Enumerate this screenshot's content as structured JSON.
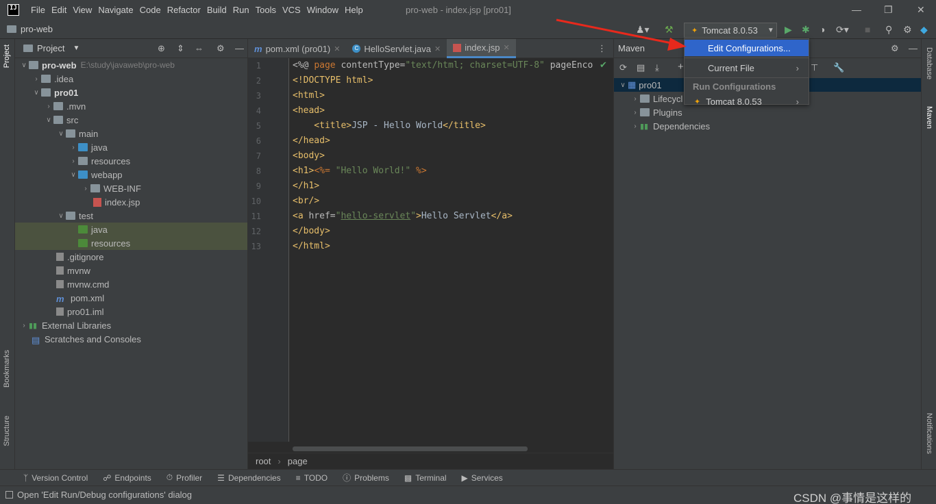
{
  "menubar": {
    "logo": "IJ",
    "items": [
      "File",
      "Edit",
      "View",
      "Navigate",
      "Code",
      "Refactor",
      "Build",
      "Run",
      "Tools",
      "VCS",
      "Window",
      "Help"
    ],
    "title": "pro-web - index.jsp [pro01]"
  },
  "navbar": {
    "project": "pro-web",
    "run_config": "Tomcat 8.0.53"
  },
  "left_strip": {
    "project": "Project",
    "bookmarks": "Bookmarks",
    "structure": "Structure"
  },
  "right_strip": {
    "database": "Database",
    "maven": "Maven",
    "notifications": "Notifications"
  },
  "project_panel": {
    "title": "Project",
    "tree": [
      {
        "label": "pro-web",
        "extra": "E:\\study\\javaweb\\pro-web"
      },
      {
        "label": ".idea"
      },
      {
        "label": "pro01"
      },
      {
        "label": ".mvn"
      },
      {
        "label": "src"
      },
      {
        "label": "main"
      },
      {
        "label": "java"
      },
      {
        "label": "resources"
      },
      {
        "label": "webapp"
      },
      {
        "label": "WEB-INF"
      },
      {
        "label": "index.jsp"
      },
      {
        "label": "test"
      },
      {
        "label": "java"
      },
      {
        "label": "resources"
      },
      {
        "label": ".gitignore"
      },
      {
        "label": "mvnw"
      },
      {
        "label": "mvnw.cmd"
      },
      {
        "label": "pom.xml"
      },
      {
        "label": "pro01.iml"
      },
      {
        "label": "External Libraries"
      },
      {
        "label": "Scratches and Consoles"
      }
    ]
  },
  "editor": {
    "tabs": [
      {
        "label": "pom.xml (pro01)"
      },
      {
        "label": "HelloServlet.java"
      },
      {
        "label": "index.jsp"
      }
    ],
    "line_numbers": [
      "1",
      "2",
      "3",
      "4",
      "5",
      "6",
      "7",
      "8",
      "9",
      "10",
      "11",
      "12",
      "13"
    ],
    "code": {
      "l1a": "<%@ ",
      "l1b": "page ",
      "l1c": "contentType=",
      "l1d": "\"text/html; charset=UTF-8\"",
      "l1e": " pageEnco",
      "l2": "<!DOCTYPE html>",
      "l3": "<html>",
      "l4": "<head>",
      "l5a": "    <title>",
      "l5b": "JSP - Hello World",
      "l5c": "</title>",
      "l6": "</head>",
      "l7": "<body>",
      "l8a": "<h1>",
      "l8b": "<%= ",
      "l8c": "\"Hello World!\"",
      "l8d": " %>",
      "l9": "</h1>",
      "l10": "<br/>",
      "l11a": "<a ",
      "l11b": "href=",
      "l11c": "\"",
      "l11d": "hello-servlet",
      "l11e": "\"",
      "l11f": ">",
      "l11g": "Hello Servlet",
      "l11h": "</a>",
      "l12": "</body>",
      "l13": "</html>"
    },
    "breadcrumb": [
      "root",
      "page"
    ]
  },
  "maven": {
    "title": "Maven",
    "tree": [
      {
        "label": "pro01"
      },
      {
        "label": "Lifecycl"
      },
      {
        "label": "Plugins"
      },
      {
        "label": "Dependencies"
      }
    ]
  },
  "popup": {
    "edit_configurations": "Edit Configurations...",
    "current_file": "Current File",
    "run_configurations_header": "Run Configurations",
    "tomcat": "Tomcat 8.0.53"
  },
  "toolwindows": [
    "Version Control",
    "Endpoints",
    "Profiler",
    "Dependencies",
    "TODO",
    "Problems",
    "Terminal",
    "Services"
  ],
  "status": {
    "message": "Open 'Edit Run/Debug configurations' dialog",
    "watermark": "CSDN @事情是这样的"
  },
  "colors": {
    "accent": "#2f65ca",
    "selection": "#4b523f",
    "arrow": "#e8291c"
  }
}
